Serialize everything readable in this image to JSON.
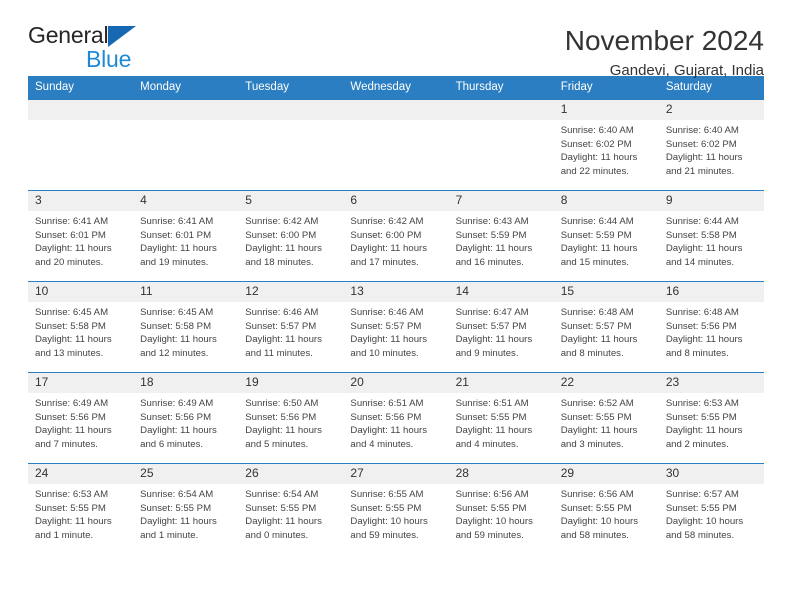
{
  "brand": {
    "name_part1": "General",
    "name_part2": "Blue"
  },
  "header": {
    "title": "November 2024",
    "location": "Gandevi, Gujarat, India"
  },
  "calendar": {
    "weekdays": [
      "Sunday",
      "Monday",
      "Tuesday",
      "Wednesday",
      "Thursday",
      "Friday",
      "Saturday"
    ],
    "accent_color": "#2b7ec1",
    "daynum_bg": "#f0f0f0",
    "weeks": [
      [
        {
          "day": "",
          "lines": []
        },
        {
          "day": "",
          "lines": []
        },
        {
          "day": "",
          "lines": []
        },
        {
          "day": "",
          "lines": []
        },
        {
          "day": "",
          "lines": []
        },
        {
          "day": "1",
          "lines": [
            "Sunrise: 6:40 AM",
            "Sunset: 6:02 PM",
            "Daylight: 11 hours and 22 minutes."
          ]
        },
        {
          "day": "2",
          "lines": [
            "Sunrise: 6:40 AM",
            "Sunset: 6:02 PM",
            "Daylight: 11 hours and 21 minutes."
          ]
        }
      ],
      [
        {
          "day": "3",
          "lines": [
            "Sunrise: 6:41 AM",
            "Sunset: 6:01 PM",
            "Daylight: 11 hours and 20 minutes."
          ]
        },
        {
          "day": "4",
          "lines": [
            "Sunrise: 6:41 AM",
            "Sunset: 6:01 PM",
            "Daylight: 11 hours and 19 minutes."
          ]
        },
        {
          "day": "5",
          "lines": [
            "Sunrise: 6:42 AM",
            "Sunset: 6:00 PM",
            "Daylight: 11 hours and 18 minutes."
          ]
        },
        {
          "day": "6",
          "lines": [
            "Sunrise: 6:42 AM",
            "Sunset: 6:00 PM",
            "Daylight: 11 hours and 17 minutes."
          ]
        },
        {
          "day": "7",
          "lines": [
            "Sunrise: 6:43 AM",
            "Sunset: 5:59 PM",
            "Daylight: 11 hours and 16 minutes."
          ]
        },
        {
          "day": "8",
          "lines": [
            "Sunrise: 6:44 AM",
            "Sunset: 5:59 PM",
            "Daylight: 11 hours and 15 minutes."
          ]
        },
        {
          "day": "9",
          "lines": [
            "Sunrise: 6:44 AM",
            "Sunset: 5:58 PM",
            "Daylight: 11 hours and 14 minutes."
          ]
        }
      ],
      [
        {
          "day": "10",
          "lines": [
            "Sunrise: 6:45 AM",
            "Sunset: 5:58 PM",
            "Daylight: 11 hours and 13 minutes."
          ]
        },
        {
          "day": "11",
          "lines": [
            "Sunrise: 6:45 AM",
            "Sunset: 5:58 PM",
            "Daylight: 11 hours and 12 minutes."
          ]
        },
        {
          "day": "12",
          "lines": [
            "Sunrise: 6:46 AM",
            "Sunset: 5:57 PM",
            "Daylight: 11 hours and 11 minutes."
          ]
        },
        {
          "day": "13",
          "lines": [
            "Sunrise: 6:46 AM",
            "Sunset: 5:57 PM",
            "Daylight: 11 hours and 10 minutes."
          ]
        },
        {
          "day": "14",
          "lines": [
            "Sunrise: 6:47 AM",
            "Sunset: 5:57 PM",
            "Daylight: 11 hours and 9 minutes."
          ]
        },
        {
          "day": "15",
          "lines": [
            "Sunrise: 6:48 AM",
            "Sunset: 5:57 PM",
            "Daylight: 11 hours and 8 minutes."
          ]
        },
        {
          "day": "16",
          "lines": [
            "Sunrise: 6:48 AM",
            "Sunset: 5:56 PM",
            "Daylight: 11 hours and 8 minutes."
          ]
        }
      ],
      [
        {
          "day": "17",
          "lines": [
            "Sunrise: 6:49 AM",
            "Sunset: 5:56 PM",
            "Daylight: 11 hours and 7 minutes."
          ]
        },
        {
          "day": "18",
          "lines": [
            "Sunrise: 6:49 AM",
            "Sunset: 5:56 PM",
            "Daylight: 11 hours and 6 minutes."
          ]
        },
        {
          "day": "19",
          "lines": [
            "Sunrise: 6:50 AM",
            "Sunset: 5:56 PM",
            "Daylight: 11 hours and 5 minutes."
          ]
        },
        {
          "day": "20",
          "lines": [
            "Sunrise: 6:51 AM",
            "Sunset: 5:56 PM",
            "Daylight: 11 hours and 4 minutes."
          ]
        },
        {
          "day": "21",
          "lines": [
            "Sunrise: 6:51 AM",
            "Sunset: 5:55 PM",
            "Daylight: 11 hours and 4 minutes."
          ]
        },
        {
          "day": "22",
          "lines": [
            "Sunrise: 6:52 AM",
            "Sunset: 5:55 PM",
            "Daylight: 11 hours and 3 minutes."
          ]
        },
        {
          "day": "23",
          "lines": [
            "Sunrise: 6:53 AM",
            "Sunset: 5:55 PM",
            "Daylight: 11 hours and 2 minutes."
          ]
        }
      ],
      [
        {
          "day": "24",
          "lines": [
            "Sunrise: 6:53 AM",
            "Sunset: 5:55 PM",
            "Daylight: 11 hours and 1 minute."
          ]
        },
        {
          "day": "25",
          "lines": [
            "Sunrise: 6:54 AM",
            "Sunset: 5:55 PM",
            "Daylight: 11 hours and 1 minute."
          ]
        },
        {
          "day": "26",
          "lines": [
            "Sunrise: 6:54 AM",
            "Sunset: 5:55 PM",
            "Daylight: 11 hours and 0 minutes."
          ]
        },
        {
          "day": "27",
          "lines": [
            "Sunrise: 6:55 AM",
            "Sunset: 5:55 PM",
            "Daylight: 10 hours and 59 minutes."
          ]
        },
        {
          "day": "28",
          "lines": [
            "Sunrise: 6:56 AM",
            "Sunset: 5:55 PM",
            "Daylight: 10 hours and 59 minutes."
          ]
        },
        {
          "day": "29",
          "lines": [
            "Sunrise: 6:56 AM",
            "Sunset: 5:55 PM",
            "Daylight: 10 hours and 58 minutes."
          ]
        },
        {
          "day": "30",
          "lines": [
            "Sunrise: 6:57 AM",
            "Sunset: 5:55 PM",
            "Daylight: 10 hours and 58 minutes."
          ]
        }
      ]
    ]
  }
}
